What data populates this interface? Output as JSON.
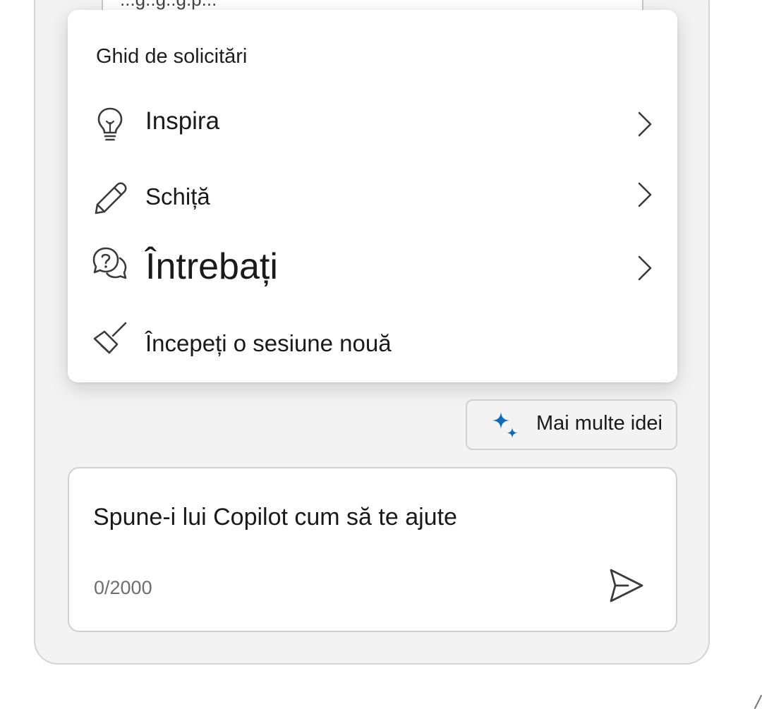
{
  "background_card": {
    "partial_text": "...g..g..g.p..."
  },
  "prompt_menu": {
    "title": "Ghid de solicitări",
    "items": [
      {
        "label": "Inspira",
        "icon": "lightbulb-icon",
        "has_submenu": true
      },
      {
        "label": "Schiță",
        "icon": "pencil-icon",
        "has_submenu": true
      },
      {
        "label": "Întrebați",
        "icon": "question-chat-icon",
        "has_submenu": true
      },
      {
        "label": "Începeți o sesiune nouă",
        "icon": "broom-icon",
        "has_submenu": false
      }
    ]
  },
  "more_ideas": {
    "label": "Mai multe idei",
    "icon": "sparkle-icon",
    "accent": "#0f6cbd"
  },
  "composer": {
    "placeholder": "Spune-i lui Copilot cum să te ajute",
    "value": "",
    "counter": "0/2000",
    "send_icon": "send-icon"
  },
  "colors": {
    "pane_bg": "#f3f3f3",
    "border": "#d1d1d1",
    "text": "#1a1a1a",
    "muted": "#6e6e6e"
  }
}
